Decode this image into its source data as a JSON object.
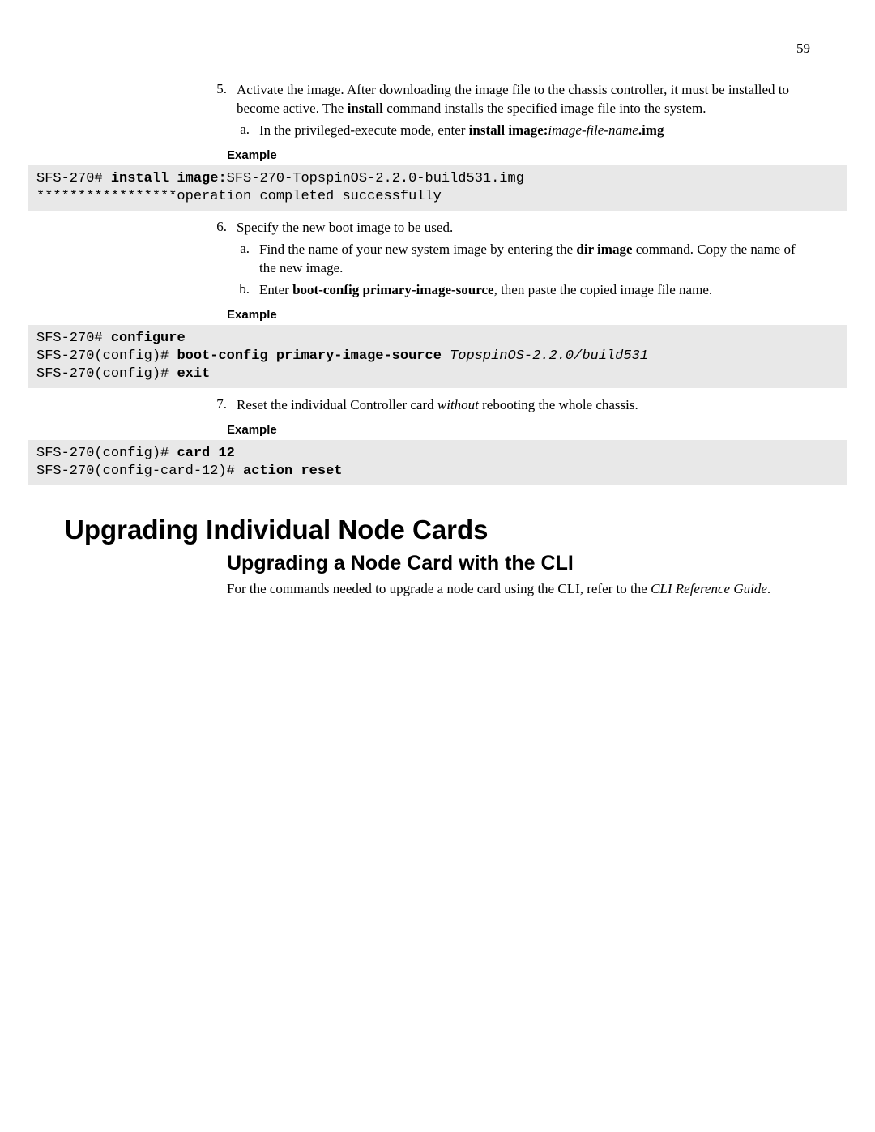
{
  "page_number": "59",
  "step5": {
    "num": "5.",
    "text_before_bold": "Activate the image. After downloading the image file to the chassis controller, it must be installed to become active. The ",
    "bold1": "install",
    "text_after_bold": " command installs the specified image file into the system."
  },
  "step5a": {
    "letter": "a.",
    "t1": "In the privileged-execute mode, enter ",
    "b1": "install image:",
    "i1": "image-file-name",
    "b2": ".img"
  },
  "example_label": "Example",
  "code1": {
    "l1a": "SFS-270# ",
    "l1b": "install image:",
    "l1c": "SFS-270-TopspinOS-2.2.0-build531.img",
    "l2": "*****************operation completed successfully"
  },
  "step6": {
    "num": "6.",
    "text": "Specify the new boot image to be used."
  },
  "step6a": {
    "letter": "a.",
    "t1": "Find the name of your new system image by entering the ",
    "b1": "dir image",
    "t2": " command. Copy the name of the new image."
  },
  "step6b": {
    "letter": "b.",
    "t1": "Enter ",
    "b1": "boot-config primary-image-source",
    "t2": ", then paste the copied image file name."
  },
  "code2": {
    "l1a": "SFS-270# ",
    "l1b": "configure",
    "l2a": "SFS-270(config)# ",
    "l2b": "boot-config primary-image-source ",
    "l2c": "TopspinOS-2.2.0/build531",
    "l3a": "SFS-270(config)# ",
    "l3b": "exit"
  },
  "step7": {
    "num": "7.",
    "t1": "Reset the individual Controller card ",
    "i1": "without",
    "t2": " rebooting the whole chassis."
  },
  "code3": {
    "l1a": "SFS-270(config)# ",
    "l1b": "card 12",
    "l2a": "SFS-270(config-card-12)# ",
    "l2b": "action reset"
  },
  "h1": "Upgrading Individual Node Cards",
  "h2": "Upgrading a Node Card with the CLI",
  "p1a": "For the commands needed to upgrade a node card using the CLI, refer to the ",
  "p1b": "CLI Reference Guide",
  "p1c": "."
}
